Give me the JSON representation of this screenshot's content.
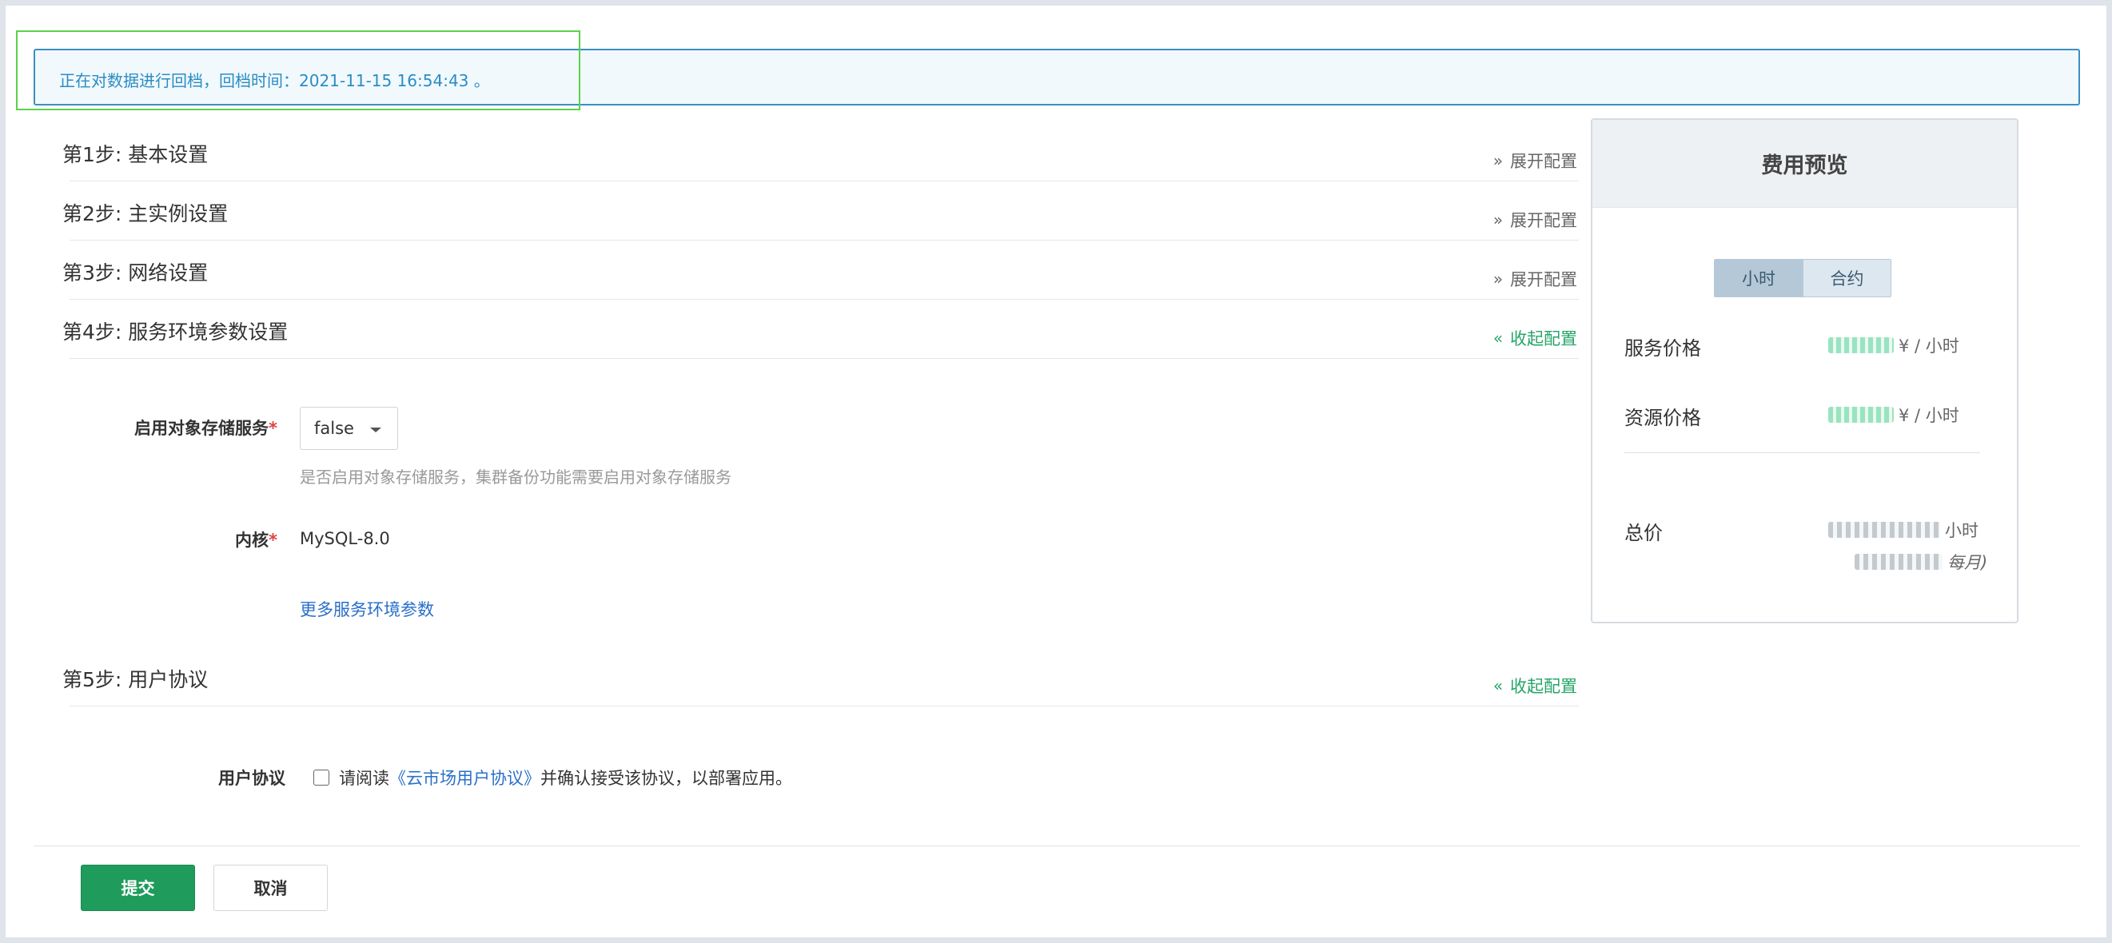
{
  "notice": {
    "text": "正在对数据进行回档，回档时间：2021-11-15 16:54:43 。"
  },
  "steps": [
    {
      "title": "第1步: 基本设置",
      "toggle": "展开配置"
    },
    {
      "title": "第2步: 主实例设置",
      "toggle": "展开配置"
    },
    {
      "title": "第3步: 网络设置",
      "toggle": "展开配置"
    },
    {
      "title": "第4步: 服务环境参数设置",
      "toggle": "收起配置"
    },
    {
      "title": "第5步: 用户协议",
      "toggle": "收起配置"
    }
  ],
  "icons": {
    "expand": "chevron-double-down-icon",
    "collapse": "chevron-double-up-icon",
    "dropdown": "caret-down-icon"
  },
  "service_env": {
    "object_storage_label": "启用对象存储服务",
    "object_storage_value": "false",
    "object_storage_hint": "是否启用对象存储服务，集群备份功能需要启用对象存储服务",
    "kernel_label": "内核",
    "kernel_value": "MySQL-8.0",
    "more_params_link": "更多服务环境参数",
    "required_mark": "*"
  },
  "agreement": {
    "label": "用户协议",
    "text_before": "请阅读",
    "link": "《云市场用户协议》",
    "text_after": "并确认接受该协议，以部署应用。",
    "checked": false
  },
  "buttons": {
    "submit": "提交",
    "cancel": "取消"
  },
  "cost_panel": {
    "title": "费用预览",
    "tabs": [
      "小时",
      "合约"
    ],
    "active_tab": "小时",
    "service_price_label": "服务价格",
    "service_price_unit": "¥ / 小时",
    "resource_price_label": "资源价格",
    "resource_price_unit": "¥ / 小时",
    "total_label": "总价",
    "total_hour_unit": "小时",
    "total_month_unit": "每月)"
  },
  "colors": {
    "primary_green": "#1f9b5c",
    "link_blue": "#2a6fc9",
    "notice_border": "#3b8fc2",
    "required_red": "#e04343",
    "highlight_box": "#5bd24a"
  }
}
